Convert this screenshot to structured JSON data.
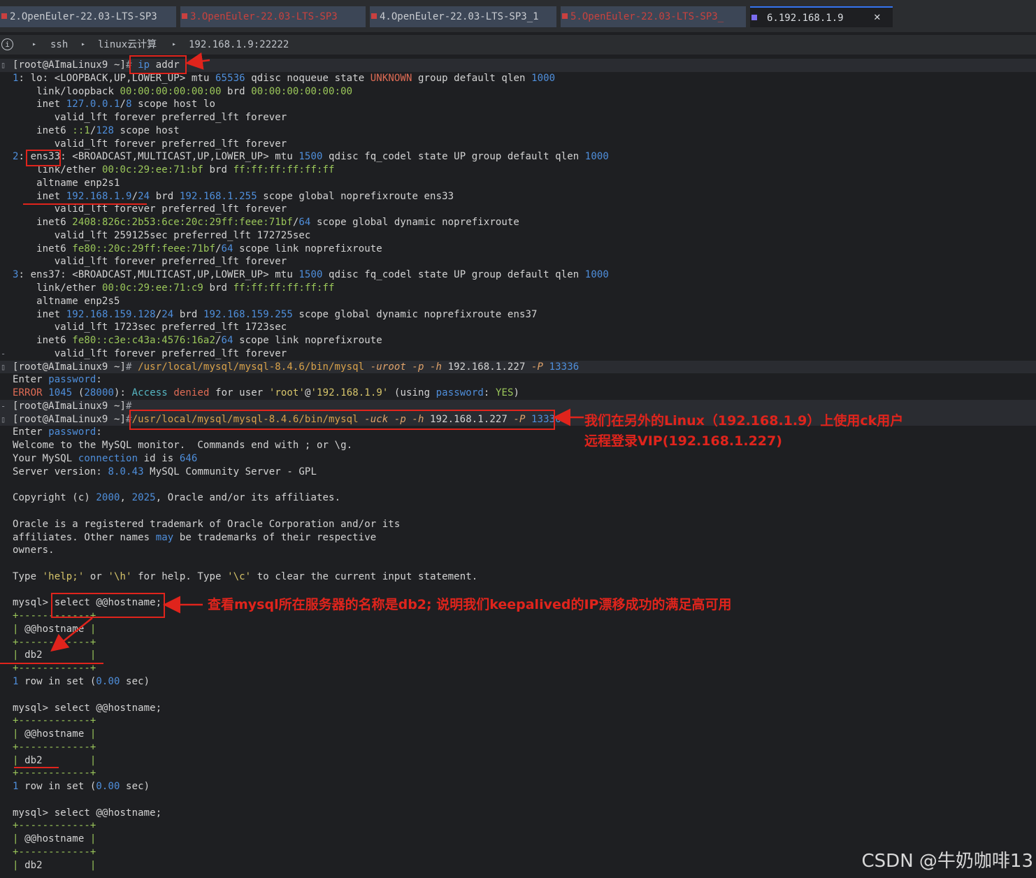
{
  "tabs": [
    {
      "label": "2.OpenEuler-22.03-LTS-SP3",
      "state": "inactive",
      "dot": "#c94040"
    },
    {
      "label": "3.OpenEuler-22.03-LTS-SP3",
      "state": "error",
      "dot": "#c94040"
    },
    {
      "label": "4.OpenEuler-22.03-LTS-SP3_1",
      "state": "inactive",
      "dot": "#c94040"
    },
    {
      "label": "5.OpenEuler-22.03-LTS-SP3_",
      "state": "error",
      "dot": "#c94040"
    },
    {
      "label": "6.192.168.1.9",
      "state": "active",
      "dot": "#7b6cf0"
    }
  ],
  "tab_close": "✕",
  "breadcrumb": {
    "info_icon": "i",
    "items": [
      "ssh",
      "linux云计算",
      "192.168.1.9:22222"
    ],
    "separator": "▸"
  },
  "terminal": {
    "lines": [
      {
        "segs": [
          [
            "p",
            "[root@AImaLinux9 ~]"
          ],
          [
            "dim",
            "# "
          ],
          [
            "b",
            "ip"
          ],
          [
            "p",
            " addr"
          ]
        ],
        "gutter": "▯",
        "hl": true
      },
      {
        "segs": [
          [
            "b",
            "1"
          ],
          [
            "p",
            ": lo: "
          ],
          [
            "p",
            "<LOOPBACK,UP,LOWER_UP>"
          ],
          [
            "p",
            " mtu "
          ],
          [
            "b",
            "65536"
          ],
          [
            "p",
            " qdisc noqueue state "
          ],
          [
            "r",
            "UNKNOWN"
          ],
          [
            "p",
            " group default qlen "
          ],
          [
            "b",
            "1000"
          ]
        ]
      },
      {
        "segs": [
          [
            "p",
            "    link/loopback "
          ],
          [
            "g",
            "00:00:00:00:00:00"
          ],
          [
            "p",
            " brd "
          ],
          [
            "g",
            "00:00:00:00:00:00"
          ]
        ]
      },
      {
        "segs": [
          [
            "p",
            "    inet "
          ],
          [
            "b",
            "127.0.0.1"
          ],
          [
            "p",
            "/"
          ],
          [
            "b",
            "8"
          ],
          [
            "p",
            " scope host lo"
          ]
        ]
      },
      {
        "segs": [
          [
            "p",
            "       valid_lft forever preferred_lft forever"
          ]
        ]
      },
      {
        "segs": [
          [
            "p",
            "    inet6 "
          ],
          [
            "g",
            "::1"
          ],
          [
            "p",
            "/"
          ],
          [
            "b",
            "128"
          ],
          [
            "p",
            " scope host"
          ]
        ]
      },
      {
        "segs": [
          [
            "p",
            "       valid_lft forever preferred_lft forever"
          ]
        ]
      },
      {
        "segs": [
          [
            "b",
            "2"
          ],
          [
            "p",
            ": ens33: "
          ],
          [
            "p",
            "<BROADCAST,MULTICAST,UP,LOWER_UP>"
          ],
          [
            "p",
            " mtu "
          ],
          [
            "b",
            "1500"
          ],
          [
            "p",
            " qdisc fq_codel state UP group default qlen "
          ],
          [
            "b",
            "1000"
          ]
        ]
      },
      {
        "segs": [
          [
            "p",
            "    link/ether "
          ],
          [
            "g",
            "00:0c:29:ee:71:bf"
          ],
          [
            "p",
            " brd "
          ],
          [
            "g",
            "ff:ff:ff:ff:ff:ff"
          ]
        ]
      },
      {
        "segs": [
          [
            "p",
            "    altname enp2s1"
          ]
        ]
      },
      {
        "segs": [
          [
            "p",
            "    inet "
          ],
          [
            "b",
            "192.168.1.9"
          ],
          [
            "p",
            "/"
          ],
          [
            "b",
            "24"
          ],
          [
            "p",
            " brd "
          ],
          [
            "b",
            "192.168.1.255"
          ],
          [
            "p",
            " scope global noprefixroute ens33"
          ]
        ]
      },
      {
        "segs": [
          [
            "p",
            "       valid_lft forever preferred_lft forever"
          ]
        ]
      },
      {
        "segs": [
          [
            "p",
            "    inet6 "
          ],
          [
            "g",
            "2408:826c:2b53:6ce:20c:29ff:feee:71bf"
          ],
          [
            "p",
            "/"
          ],
          [
            "b",
            "64"
          ],
          [
            "p",
            " scope global dynamic noprefixroute"
          ]
        ]
      },
      {
        "segs": [
          [
            "p",
            "       valid_lft 259125sec preferred_lft 172725sec"
          ]
        ]
      },
      {
        "segs": [
          [
            "p",
            "    inet6 "
          ],
          [
            "g",
            "fe80::20c:29ff:feee:71bf"
          ],
          [
            "p",
            "/"
          ],
          [
            "b",
            "64"
          ],
          [
            "p",
            " scope link noprefixroute"
          ]
        ]
      },
      {
        "segs": [
          [
            "p",
            "       valid_lft forever preferred_lft forever"
          ]
        ]
      },
      {
        "segs": [
          [
            "b",
            "3"
          ],
          [
            "p",
            ": ens37: "
          ],
          [
            "p",
            "<BROADCAST,MULTICAST,UP,LOWER_UP>"
          ],
          [
            "p",
            " mtu "
          ],
          [
            "b",
            "1500"
          ],
          [
            "p",
            " qdisc fq_codel state UP group default qlen "
          ],
          [
            "b",
            "1000"
          ]
        ]
      },
      {
        "segs": [
          [
            "p",
            "    link/ether "
          ],
          [
            "g",
            "00:0c:29:ee:71:c9"
          ],
          [
            "p",
            " brd "
          ],
          [
            "g",
            "ff:ff:ff:ff:ff:ff"
          ]
        ]
      },
      {
        "segs": [
          [
            "p",
            "    altname enp2s5"
          ]
        ]
      },
      {
        "segs": [
          [
            "p",
            "    inet "
          ],
          [
            "b",
            "192.168.159.128"
          ],
          [
            "p",
            "/"
          ],
          [
            "b",
            "24"
          ],
          [
            "p",
            " brd "
          ],
          [
            "b",
            "192.168.159.255"
          ],
          [
            "p",
            " scope global dynamic noprefixroute ens37"
          ]
        ]
      },
      {
        "segs": [
          [
            "p",
            "       valid_lft 1723sec preferred_lft 1723sec"
          ]
        ]
      },
      {
        "segs": [
          [
            "p",
            "    inet6 "
          ],
          [
            "g",
            "fe80::c3e:c43a:4576:16a2"
          ],
          [
            "p",
            "/"
          ],
          [
            "b",
            "64"
          ],
          [
            "p",
            " scope link noprefixroute"
          ]
        ]
      },
      {
        "segs": [
          [
            "p",
            "       valid_lft forever preferred_lft forever"
          ]
        ],
        "gutter": "-"
      },
      {
        "segs": [
          [
            "p",
            "[root@AImaLinux9 ~]"
          ],
          [
            "dim",
            "# "
          ],
          [
            "o",
            "/usr/local/mysql/mysql-8.4.6/bin/mysql "
          ],
          [
            "i",
            "-uroot -p -h "
          ],
          [
            "p",
            "192.168.1.227 "
          ],
          [
            "i",
            "-P "
          ],
          [
            "b",
            "13336"
          ]
        ],
        "gutter": "▯",
        "hl": true
      },
      {
        "segs": [
          [
            "p",
            "Enter "
          ],
          [
            "b",
            "password"
          ],
          [
            "p",
            ":"
          ]
        ]
      },
      {
        "segs": [
          [
            "r",
            "ERROR "
          ],
          [
            "b",
            "1045"
          ],
          [
            "p",
            " ("
          ],
          [
            "b",
            "28000"
          ],
          [
            "p",
            "): "
          ],
          [
            "cy",
            "Access"
          ],
          [
            "r",
            " denied"
          ],
          [
            "p",
            " for user "
          ],
          [
            "y",
            "'root'"
          ],
          [
            "p",
            "@"
          ],
          [
            "y",
            "'192.168.1.9'"
          ],
          [
            "p",
            " (using "
          ],
          [
            "b",
            "password"
          ],
          [
            "p",
            ": "
          ],
          [
            "g",
            "YES"
          ],
          [
            "p",
            ")"
          ]
        ]
      },
      {
        "segs": [
          [
            "p",
            "[root@AImaLinux9 ~]"
          ],
          [
            "dim",
            "#"
          ]
        ],
        "gutter": "-",
        "hl": true
      },
      {
        "segs": [
          [
            "p",
            "[root@AImaLinux9 ~]"
          ],
          [
            "dim",
            "#"
          ],
          [
            "o",
            "/usr/local/mysql/mysql-8.4.6/bin/mysql "
          ],
          [
            "i",
            "-uck -p -h "
          ],
          [
            "p",
            "192.168.1.227 "
          ],
          [
            "i",
            "-P "
          ],
          [
            "b",
            "13336"
          ]
        ],
        "gutter": "▯",
        "hl": true
      },
      {
        "segs": [
          [
            "p",
            "Enter "
          ],
          [
            "b",
            "password"
          ],
          [
            "p",
            ":"
          ]
        ]
      },
      {
        "segs": [
          [
            "p",
            "Welcome to the MySQL monitor.  Commands end with ; or \\g."
          ]
        ]
      },
      {
        "segs": [
          [
            "p",
            "Your MySQL "
          ],
          [
            "b",
            "connection"
          ],
          [
            "p",
            " id is "
          ],
          [
            "b",
            "646"
          ]
        ]
      },
      {
        "segs": [
          [
            "p",
            "Server version: "
          ],
          [
            "b",
            "8.0.43"
          ],
          [
            "p",
            " MySQL Community Server - GPL"
          ]
        ]
      },
      {
        "segs": [
          [
            "p",
            ""
          ]
        ]
      },
      {
        "segs": [
          [
            "p",
            "Copyright (c) "
          ],
          [
            "b",
            "2000"
          ],
          [
            "p",
            ", "
          ],
          [
            "b",
            "2025"
          ],
          [
            "p",
            ", Oracle and/or its affiliates."
          ]
        ]
      },
      {
        "segs": [
          [
            "p",
            ""
          ]
        ]
      },
      {
        "segs": [
          [
            "p",
            "Oracle is a registered trademark of Oracle Corporation and/or its"
          ]
        ]
      },
      {
        "segs": [
          [
            "p",
            "affiliates. Other names "
          ],
          [
            "b",
            "may"
          ],
          [
            "p",
            " be trademarks of their respective"
          ]
        ]
      },
      {
        "segs": [
          [
            "p",
            "owners."
          ]
        ]
      },
      {
        "segs": [
          [
            "p",
            ""
          ]
        ]
      },
      {
        "segs": [
          [
            "p",
            "Type "
          ],
          [
            "y",
            "'help;'"
          ],
          [
            "p",
            " or "
          ],
          [
            "y",
            "'\\h'"
          ],
          [
            "p",
            " for help. Type "
          ],
          [
            "y",
            "'\\c'"
          ],
          [
            "p",
            " to clear the current input statement."
          ]
        ]
      },
      {
        "segs": [
          [
            "p",
            ""
          ]
        ]
      },
      {
        "segs": [
          [
            "p",
            "mysql> select @@hostname;"
          ]
        ]
      },
      {
        "segs": [
          [
            "g",
            "+------------+"
          ]
        ]
      },
      {
        "segs": [
          [
            "g",
            "| "
          ],
          [
            "p",
            "@@hostname"
          ],
          [
            "g",
            " |"
          ]
        ]
      },
      {
        "segs": [
          [
            "g",
            "+------------+"
          ]
        ]
      },
      {
        "segs": [
          [
            "g",
            "| "
          ],
          [
            "p",
            "db2"
          ],
          [
            "g",
            "        |"
          ]
        ]
      },
      {
        "segs": [
          [
            "g",
            "+------------+"
          ]
        ]
      },
      {
        "segs": [
          [
            "b",
            "1"
          ],
          [
            "p",
            " row in set ("
          ],
          [
            "b",
            "0.00"
          ],
          [
            "p",
            " sec)"
          ]
        ]
      },
      {
        "segs": [
          [
            "p",
            ""
          ]
        ]
      },
      {
        "segs": [
          [
            "p",
            "mysql> select @@hostname;"
          ]
        ]
      },
      {
        "segs": [
          [
            "g",
            "+------------+"
          ]
        ]
      },
      {
        "segs": [
          [
            "g",
            "| "
          ],
          [
            "p",
            "@@hostname"
          ],
          [
            "g",
            " |"
          ]
        ]
      },
      {
        "segs": [
          [
            "g",
            "+------------+"
          ]
        ]
      },
      {
        "segs": [
          [
            "g",
            "| "
          ],
          [
            "p",
            "db2"
          ],
          [
            "g",
            "        |"
          ]
        ]
      },
      {
        "segs": [
          [
            "g",
            "+------------+"
          ]
        ]
      },
      {
        "segs": [
          [
            "b",
            "1"
          ],
          [
            "p",
            " row in set ("
          ],
          [
            "b",
            "0.00"
          ],
          [
            "p",
            " sec)"
          ]
        ]
      },
      {
        "segs": [
          [
            "p",
            ""
          ]
        ]
      },
      {
        "segs": [
          [
            "p",
            "mysql> select @@hostname;"
          ]
        ]
      },
      {
        "segs": [
          [
            "g",
            "+------------+"
          ]
        ]
      },
      {
        "segs": [
          [
            "g",
            "| "
          ],
          [
            "p",
            "@@hostname"
          ],
          [
            "g",
            " |"
          ]
        ]
      },
      {
        "segs": [
          [
            "g",
            "+------------+"
          ]
        ]
      },
      {
        "segs": [
          [
            "g",
            "| "
          ],
          [
            "p",
            "db2"
          ],
          [
            "g",
            "        |"
          ]
        ]
      }
    ]
  },
  "annotations": {
    "note1_line1": "我们在另外的Linux（192.168.1.9）上使用ck用户",
    "note1_line2": "远程登录VIP(192.168.1.227)",
    "note2": "查看mysql所在服务器的名称是db2;  说明我们keepalived的IP漂移成功的满足高可用",
    "color": "#e0241c"
  },
  "watermark": "CSDN @牛奶咖啡13"
}
